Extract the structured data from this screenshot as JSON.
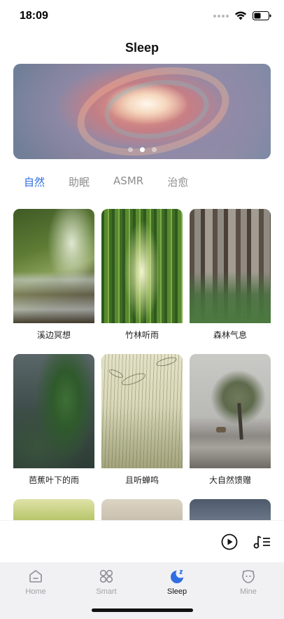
{
  "status_bar": {
    "time": "18:09",
    "icons": [
      "signal-dots-icon",
      "wifi-icon",
      "battery-icon"
    ]
  },
  "page": {
    "title": "Sleep"
  },
  "banner": {
    "slides": 3,
    "active_slide": 2
  },
  "categories": {
    "active": "自然",
    "tabs": [
      {
        "label": "自然"
      },
      {
        "label": "助眠"
      },
      {
        "label": "ASMR"
      },
      {
        "label": "治愈"
      }
    ]
  },
  "sounds": [
    {
      "title": "溪边冥想"
    },
    {
      "title": "竹林听雨"
    },
    {
      "title": "森林气息"
    },
    {
      "title": "芭蕉叶下的雨"
    },
    {
      "title": "且听蝉鸣"
    },
    {
      "title": "大自然馈赠"
    }
  ],
  "player": {
    "icons": [
      "play-icon",
      "playlist-icon"
    ]
  },
  "tabbar": {
    "active": "Sleep",
    "items": [
      {
        "label": "Home",
        "icon": "home-icon"
      },
      {
        "label": "Smart",
        "icon": "smart-icon"
      },
      {
        "label": "Sleep",
        "icon": "sleep-moon-icon"
      },
      {
        "label": "Mine",
        "icon": "mine-face-icon"
      }
    ]
  },
  "colors": {
    "accent": "#2f6ee0",
    "tab_inactive": "#8d8d8d",
    "tabbar_bg": "#f1f1f4"
  }
}
